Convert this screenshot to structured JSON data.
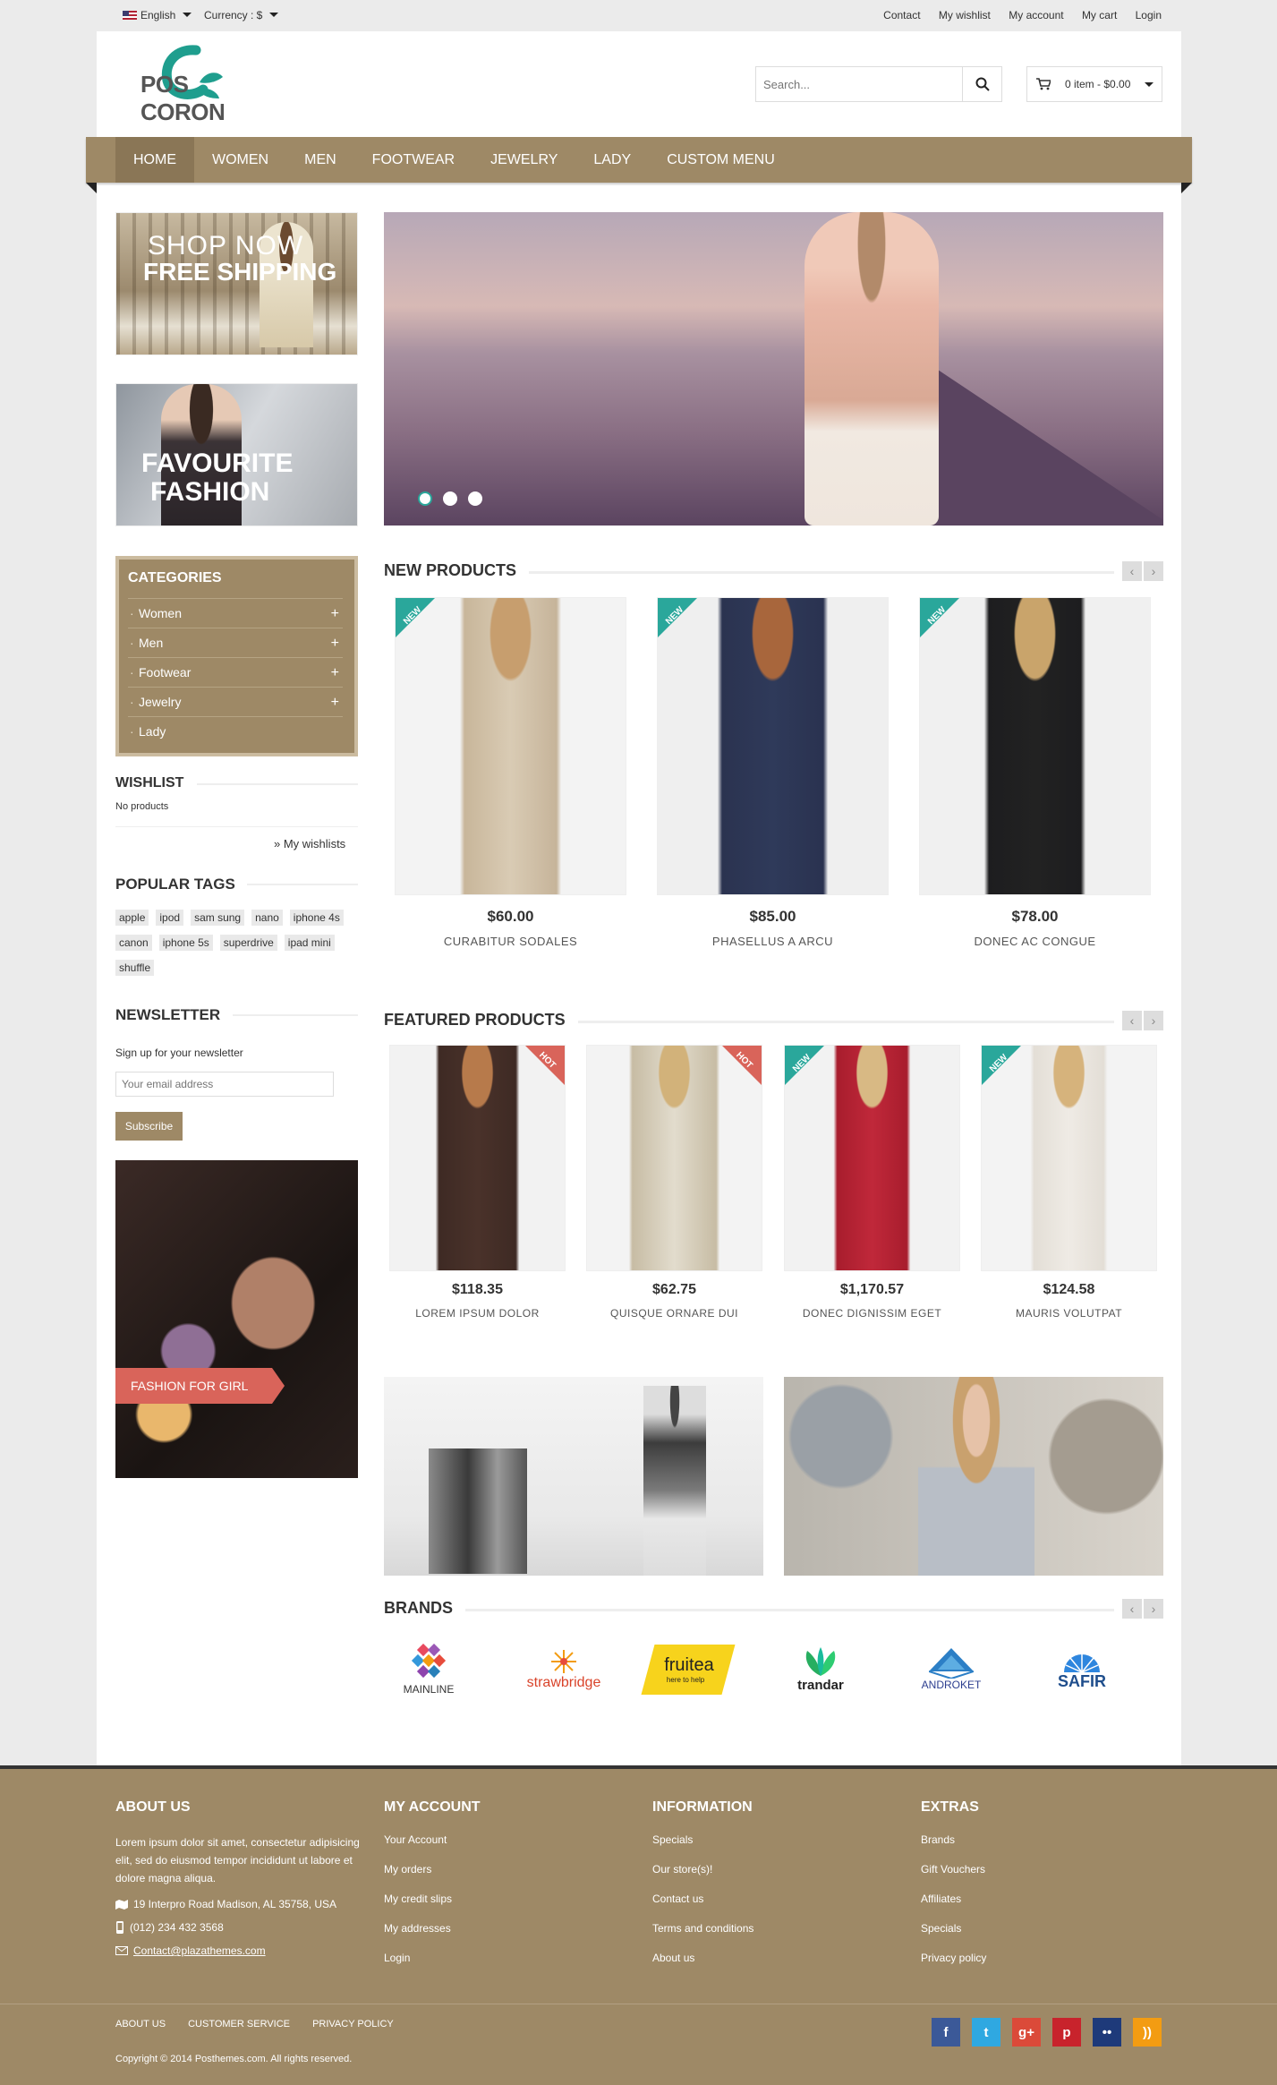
{
  "topbar": {
    "language": "English",
    "currency": "Currency : $",
    "links": [
      "Contact",
      "My wishlist",
      "My account",
      "My cart",
      "Login"
    ]
  },
  "header": {
    "logo_text": "POS CORON",
    "search_placeholder": "Search...",
    "cart_text": "0 item - $0.00"
  },
  "nav": [
    "HOME",
    "WOMEN",
    "MEN",
    "FOOTWEAR",
    "JEWELRY",
    "LADY",
    "CUSTOM MENU"
  ],
  "side_banners": {
    "shop_now": "SHOP NOW",
    "free_shipping": "FREE SHIPPING",
    "favourite": "FAVOURITE",
    "fashion": "FASHION"
  },
  "categories": {
    "title": "CATEGORIES",
    "items": [
      {
        "label": "Women",
        "plus": "+"
      },
      {
        "label": "Men",
        "plus": "+"
      },
      {
        "label": "Footwear",
        "plus": "+"
      },
      {
        "label": "Jewelry",
        "plus": "+"
      },
      {
        "label": "Lady",
        "plus": ""
      }
    ]
  },
  "wishlist": {
    "title": "WISHLIST",
    "empty": "No products",
    "link": "» My wishlists"
  },
  "tags": {
    "title": "POPULAR TAGS",
    "items": [
      "apple",
      "ipod",
      "sam sung",
      "nano",
      "iphone 4s",
      "canon",
      "iphone 5s",
      "superdrive",
      "ipad mini",
      "shuffle"
    ]
  },
  "newsletter": {
    "title": "NEWSLETTER",
    "text": "Sign up for your newsletter",
    "placeholder": "Your email address",
    "button": "Subscribe"
  },
  "fashion_banner": "FASHION FOR GIRL",
  "new_products": {
    "title": "NEW PRODUCTS",
    "items": [
      {
        "price": "$60.00",
        "name": "CURABITUR SODALES",
        "badge": "NEW"
      },
      {
        "price": "$85.00",
        "name": "PHASELLUS A ARCU",
        "badge": "NEW"
      },
      {
        "price": "$78.00",
        "name": "DONEC AC CONGUE",
        "badge": "NEW"
      }
    ]
  },
  "featured_products": {
    "title": "FEATURED PRODUCTS",
    "items": [
      {
        "price": "$118.35",
        "name": "LOREM IPSUM DOLOR",
        "badge": "HOT"
      },
      {
        "price": "$62.75",
        "name": "QUISQUE ORNARE DUI",
        "badge": "HOT"
      },
      {
        "price": "$1,170.57",
        "name": "DONEC DIGNISSIM EGET",
        "badge": "NEW"
      },
      {
        "price": "$124.58",
        "name": "MAURIS VOLUTPAT",
        "badge": "NEW"
      }
    ]
  },
  "brands": {
    "title": "BRANDS",
    "items": [
      "MAINLINE",
      "strawbridge",
      "fruitea",
      "trandar",
      "ANDROKET",
      "SAFIR"
    ],
    "fruitea_sub": "here to help"
  },
  "footer": {
    "about": {
      "title": "ABOUT US",
      "text": "Lorem ipsum dolor sit amet, consectetur adipisicing elit, sed do eiusmod tempor incididunt ut labore et dolore magna aliqua.",
      "address": "19 Interpro Road Madison, AL 35758, USA",
      "phone": "(012) 234 432 3568",
      "email": "Contact@plazathemes.com"
    },
    "account": {
      "title": "MY ACCOUNT",
      "items": [
        "Your Account",
        "My orders",
        "My credit slips",
        "My addresses",
        "Login"
      ]
    },
    "information": {
      "title": "INFORMATION",
      "items": [
        "Specials",
        "Our store(s)!",
        "Contact us",
        "Terms and conditions",
        "About us"
      ]
    },
    "extras": {
      "title": "EXTRAS",
      "items": [
        "Brands",
        "Gift Vouchers",
        "Affiliates",
        "Specials",
        "Privacy policy"
      ]
    },
    "bottom_links": [
      "ABOUT US",
      "CUSTOMER SERVICE",
      "PRIVACY POLICY"
    ],
    "copyright": "Copyright © 2014 Posthemes.com. All rights reserved.",
    "social": [
      {
        "icon": "facebook-icon",
        "glyph": "f",
        "color": "#3b5998"
      },
      {
        "icon": "twitter-icon",
        "glyph": "t",
        "color": "#2fa8e1"
      },
      {
        "icon": "google-plus-icon",
        "glyph": "g+",
        "color": "#db4a39"
      },
      {
        "icon": "pinterest-icon",
        "glyph": "p",
        "color": "#c8232c"
      },
      {
        "icon": "flickr-icon",
        "glyph": "••",
        "color": "#1e3a7a"
      },
      {
        "icon": "rss-icon",
        "glyph": "))",
        "color": "#f39c12"
      }
    ]
  }
}
